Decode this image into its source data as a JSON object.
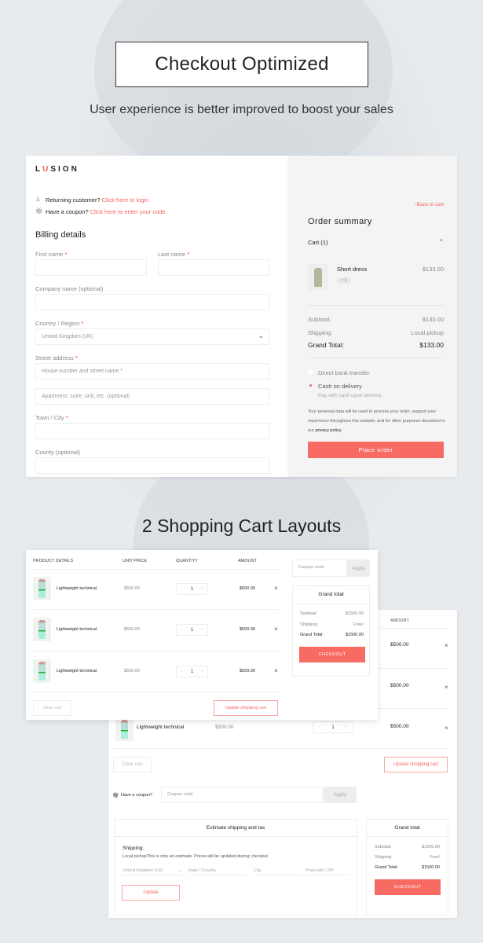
{
  "hero": {
    "title": "Checkout Optimized",
    "subtitle": "User experience is better improved to boost your sales"
  },
  "checkout": {
    "logo": "LUSION",
    "returning_text": "Returning customer?",
    "login_link": "Click here to login",
    "coupon_text": "Have a coupon?",
    "coupon_link": "Click here to enter your code",
    "billing_title": "Billing details",
    "fields": {
      "first_name": "First name",
      "last_name": "Last name",
      "company": "Company name (optional)",
      "country": "Country / Region",
      "country_value": "United Kingdom (UK)",
      "street": "Street address",
      "street_ph1": "House number and street name *",
      "street_ph2": "Apartment, suite, unit, etc. (optional)",
      "town": "Town / City",
      "county": "County (optional)",
      "required_mark": "*"
    },
    "summary": {
      "back_link": "Back to cart",
      "title": "Order summary",
      "cart_label": "Cart (1)",
      "item_name": "Short dress",
      "item_qty": "× 1",
      "item_price": "$133.00",
      "subtotal_label": "Subtotal:",
      "subtotal": "$133.00",
      "shipping_label": "Shipping:",
      "shipping": "Local pickup",
      "grand_label": "Grand Total:",
      "grand": "$133.00",
      "pay_bank": "Direct bank transfer",
      "pay_cod": "Cash on delivery",
      "pay_cod_desc": "Pay with cash upon delivery.",
      "privacy_text": "Your personal data will be used to process your order, support your experience throughout this website, and for other purposes described in our",
      "privacy_link": "privacy policy",
      "privacy_end": ".",
      "place_order": "Place order"
    }
  },
  "section2_title": "2 Shopping Cart Layouts",
  "cart1": {
    "headers": [
      "PRODUCT DETAILS",
      "UNIT PRICE",
      "QUANTITY",
      "AMOUNT"
    ],
    "rows": [
      {
        "name": "Lightweight technical",
        "price": "$500.00",
        "qty": "1",
        "amount": "$500.00"
      },
      {
        "name": "Lightweight technical",
        "price": "$500.00",
        "qty": "1",
        "amount": "$500.00"
      },
      {
        "name": "Lightweight technical",
        "price": "$500.00",
        "qty": "1",
        "amount": "$500.00"
      }
    ],
    "clear": "Clear cart",
    "update": "Update shopping cart",
    "coupon_ph": "Coupon code",
    "apply": "Apply",
    "totals": {
      "title": "Grand total",
      "subtotal_label": "Subtotal:",
      "subtotal": "$1500.00",
      "shipping_label": "Shipping:",
      "shipping": "Free!",
      "grand_label": "Grand Total:",
      "grand": "$1500.00",
      "checkout": "CHECKOUT"
    }
  },
  "cart2": {
    "amount_header": "AMOUNT",
    "amounts": [
      "$500.00",
      "$500.00",
      "$500.00"
    ],
    "row3_name": "Lightweight technical",
    "row3_price": "$500.00",
    "row3_qty": "1",
    "clear": "Clear cart",
    "update": "Update shopping cart",
    "coupon_label": "Have a coupon?",
    "coupon_ph": "Coupon code",
    "apply": "Apply",
    "estimate": {
      "title": "Estimate shipping and tax",
      "shipping_label": "Shipping:",
      "note": "Local pickupThis is only an estimate. Prices will be updated during checkout.",
      "country": "United Kingdom (UK)",
      "state_ph": "State / Country",
      "city_ph": "City",
      "zip_ph": "Postcode / ZIP",
      "update": "Update"
    },
    "totals": {
      "title": "Grand total",
      "subtotal_label": "Subtotal:",
      "subtotal": "$1500.00",
      "shipping_label": "Shipping:",
      "shipping": "Free!",
      "grand_label": "Grand Total:",
      "grand": "$1500.00",
      "checkout": "CHECKOUT"
    }
  },
  "colors": {
    "accent": "#f76b63",
    "link": "#f4645f",
    "summary_bg": "#f4f4f4"
  }
}
